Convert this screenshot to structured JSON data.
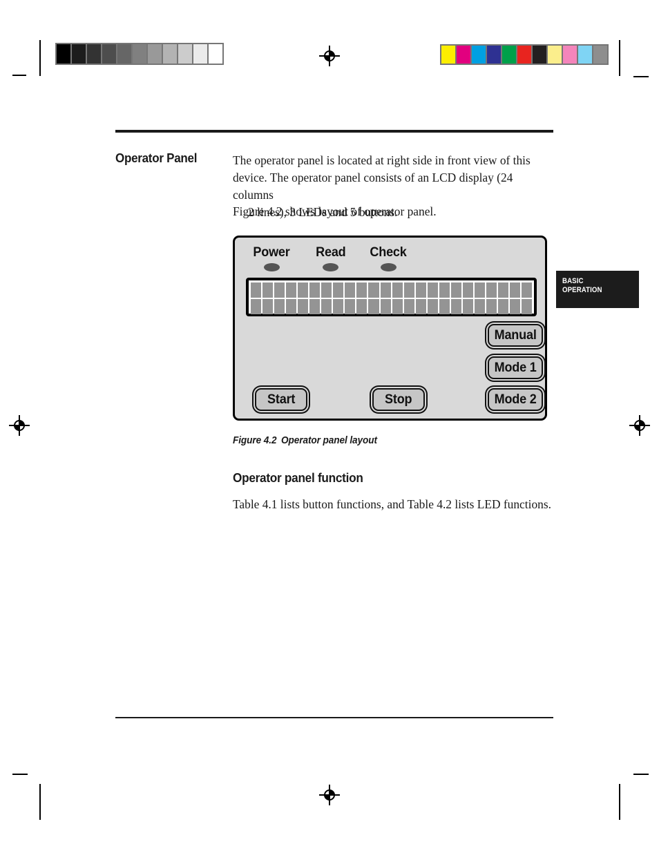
{
  "page": {
    "section_title": "Operator Panel",
    "paragraphs": {
      "p1_line1": "The operator panel is located at right side in front view of this",
      "p1_line2": "device. The operator panel consists of an LCD display (24 columns",
      "p1_line3": "2 lines), 3 LEDs and 5 buttons.",
      "p2": "Figure 4.2 shows layout of operator panel.",
      "p3": "Table 4.1 lists button functions, and Table 4.2 lists LED functions."
    },
    "figure_caption": {
      "number": "Figure 4.2",
      "title": "Operator panel layout"
    },
    "subheading": "Operator panel function",
    "side_tab": {
      "line1": "BASIC",
      "line2": "OPERATION",
      "background": "#1c1c1c",
      "text_color": "#ffffff"
    }
  },
  "figure": {
    "panel": {
      "background": "#d9d9d9",
      "border_color": "#000000"
    },
    "leds": [
      {
        "label": "Power",
        "color": "#555555"
      },
      {
        "label": "Read",
        "color": "#555555"
      },
      {
        "label": "Check",
        "color": "#555555"
      }
    ],
    "lcd": {
      "columns": 24,
      "lines": 2,
      "cell_color": "#949494",
      "background": "#ffffff"
    },
    "buttons": [
      {
        "label": "Start",
        "name": "start"
      },
      {
        "label": "Stop",
        "name": "stop"
      },
      {
        "label": "Manual",
        "name": "manual"
      },
      {
        "label": "Mode 1",
        "name": "mode-1"
      },
      {
        "label": "Mode 2",
        "name": "mode-2"
      }
    ],
    "button_fill": "#c6c6c6"
  },
  "calibration": {
    "grayscale_swatches": [
      "#000000",
      "#1c1c1c",
      "#333333",
      "#4d4d4d",
      "#666666",
      "#808080",
      "#999999",
      "#b3b3b3",
      "#cccccc",
      "#ebebeb",
      "#ffffff"
    ],
    "color_swatches": [
      "#fdee00",
      "#e2007f",
      "#00a0e2",
      "#2e3192",
      "#00a04a",
      "#e8241f",
      "#231f20",
      "#fbee8c",
      "#f485bb",
      "#7fd4f4",
      "#8e8e8e"
    ]
  }
}
